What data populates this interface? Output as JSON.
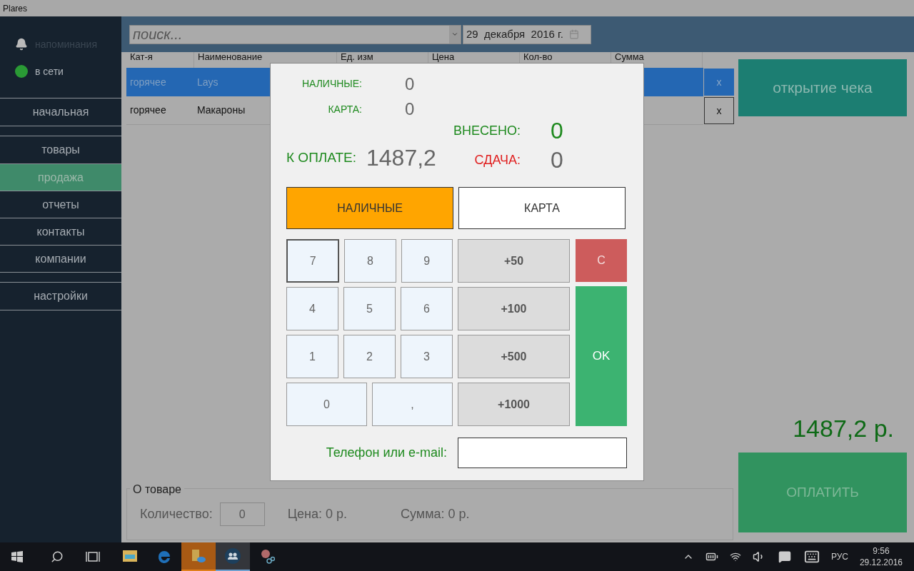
{
  "window": {
    "title": "Plares"
  },
  "sidebar": {
    "status": [
      {
        "kind": "reminders",
        "label": "напоминания"
      },
      {
        "kind": "online",
        "label": "в сети"
      }
    ],
    "nav_groups": [
      [
        {
          "label": "начальная",
          "selected": false
        }
      ],
      [
        {
          "label": "товары",
          "selected": false
        },
        {
          "label": "продажа",
          "selected": true
        },
        {
          "label": "отчеты",
          "selected": false
        },
        {
          "label": "контакты",
          "selected": false
        },
        {
          "label": "компании",
          "selected": false
        }
      ],
      [
        {
          "label": "настройки",
          "selected": false
        }
      ]
    ]
  },
  "search": {
    "placeholder": "поиск..."
  },
  "date": "29  декабря  2016 г.",
  "table": {
    "columns": [
      "Кат-я",
      "Наименование",
      "Ед. изм",
      "Цена",
      "Кол-во",
      "Сумма"
    ],
    "rows": [
      {
        "cells": [
          "горячее",
          "Lays"
        ],
        "selected": true,
        "remove": "x"
      },
      {
        "cells": [
          "горячее",
          "Макароны"
        ],
        "selected": false,
        "remove": "x"
      }
    ]
  },
  "open_check": "открытие чека",
  "total": "1487,2 р.",
  "pay": {
    "label": "ОПЛАТИТЬ",
    "disabled": true
  },
  "product_info": {
    "legend": "О товаре",
    "quantity_label": "Количество:",
    "quantity": "0",
    "price": "Цена: 0 р.",
    "sum": "Сумма: 0 р."
  },
  "payment": {
    "cash_label": "НАЛИЧНЫЕ:",
    "cash_value": "0",
    "card_label": "КАРТА:",
    "card_value": "0",
    "deposited_label": "ВНЕСЕНО:",
    "deposited_value": "0",
    "due_label": "К ОПЛАТЕ:",
    "due_value": "1487,2",
    "change_label": "СДАЧА:",
    "change_value": "0",
    "methods": [
      {
        "label": "НАЛИЧНЫЕ",
        "selected": true
      },
      {
        "label": "КАРТА",
        "selected": false
      }
    ],
    "keys": [
      [
        {
          "label": "7",
          "focused": true
        },
        {
          "label": "8",
          "focused": false
        },
        {
          "label": "9",
          "focused": false
        }
      ],
      [
        {
          "label": "4",
          "focused": false
        },
        {
          "label": "5",
          "focused": false
        },
        {
          "label": "6",
          "focused": false
        }
      ],
      [
        {
          "label": "1",
          "focused": false
        },
        {
          "label": "2",
          "focused": false
        },
        {
          "label": "3",
          "focused": false
        }
      ],
      [
        {
          "label": "0",
          "focused": false
        },
        {
          "label": ",",
          "focused": false
        }
      ]
    ],
    "quick": [
      "+50",
      "+100",
      "+500",
      "+1000"
    ],
    "clear": "C",
    "ok": "OK",
    "contact_label": "Телефон или e-mail:"
  },
  "taskbar": {
    "apps": [
      {
        "kind": "explorer",
        "active": false
      },
      {
        "kind": "edge",
        "active": false
      },
      {
        "kind": "files",
        "active": true
      },
      {
        "kind": "people",
        "active": true
      },
      {
        "kind": "snip",
        "active": false
      }
    ],
    "language": "РУС",
    "time": "9:56",
    "date": "29.12.2016"
  }
}
